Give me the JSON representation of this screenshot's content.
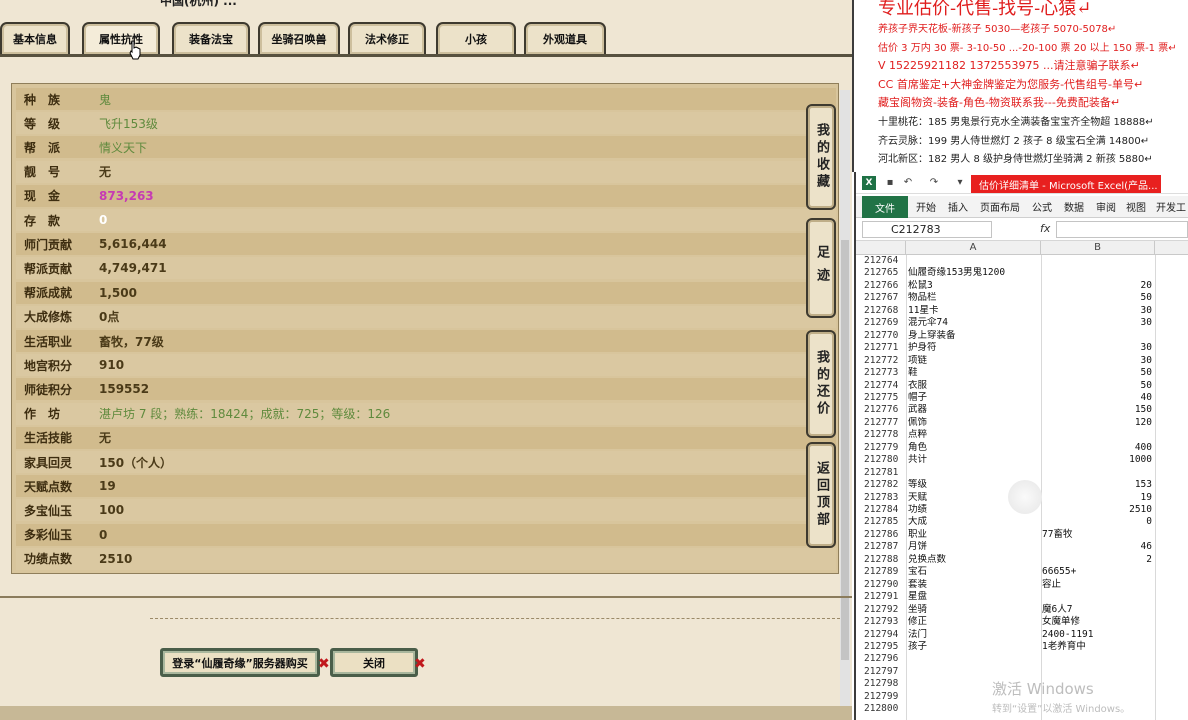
{
  "game": {
    "top_text": "中国(杭州) ...",
    "tabs": [
      "基本信息",
      "属性抗性",
      "装备法宝",
      "坐骑召唤兽",
      "法术修正",
      "小孩",
      "外观道具"
    ],
    "attributes": [
      {
        "label": "种　族",
        "value": "鬼",
        "style": "green"
      },
      {
        "label": "等　级",
        "value": "飞升153级",
        "style": "green"
      },
      {
        "label": "帮　派",
        "value": "情义天下",
        "style": "green"
      },
      {
        "label": "靓　号",
        "value": "无",
        "style": "normal"
      },
      {
        "label": "现　金",
        "value": "873,263",
        "style": "pink"
      },
      {
        "label": "存　款",
        "value": "0",
        "style": "white"
      },
      {
        "label": "师门贡献",
        "value": "5,616,444",
        "style": "normal"
      },
      {
        "label": "帮派贡献",
        "value": "4,749,471",
        "style": "normal"
      },
      {
        "label": "帮派成就",
        "value": "1,500",
        "style": "normal"
      },
      {
        "label": "大成修炼",
        "value": "0点",
        "style": "normal"
      },
      {
        "label": "生活职业",
        "value": "畜牧，77级",
        "style": "normal"
      },
      {
        "label": "地宫积分",
        "value": "910",
        "style": "normal"
      },
      {
        "label": "师徒积分",
        "value": "159552",
        "style": "normal"
      },
      {
        "label": "作　坊",
        "value": "湛卢坊 7 段；熟练：18424；成就：725；等级：126",
        "style": "green"
      },
      {
        "label": "生活技能",
        "value": "无",
        "style": "normal"
      },
      {
        "label": "家具回灵",
        "value": "150（个人）",
        "style": "normal"
      },
      {
        "label": "天赋点数",
        "value": "19",
        "style": "normal"
      },
      {
        "label": "多宝仙玉",
        "value": "100",
        "style": "normal"
      },
      {
        "label": "多彩仙玉",
        "value": "0",
        "style": "normal"
      },
      {
        "label": "功绩点数",
        "value": "2510",
        "style": "normal"
      }
    ],
    "side_buttons": [
      "我的收藏",
      "足迹",
      "我的还价",
      "返回顶部"
    ],
    "login_button": "登录“仙履奇缘”服务器购买",
    "close_button": "关闭"
  },
  "ad": {
    "title": "专业估价-代售-找号-心猿↵",
    "lines": [
      {
        "text": "养孩子界天花板-新孩子 5030—老孩子 5070-5078↵",
        "color": "red"
      },
      {
        "text": "估价 3 万内 30 票- 3-10-50 ...-20-100 票 20 以上 150 票-1 票↵",
        "color": "red"
      },
      {
        "text": "V 15225921182    1372553975   ...请注意骗子联系↵",
        "color": "red"
      },
      {
        "text": "CC 首席鉴定+大神金牌鉴定为您服务-代售组号-单号↵",
        "color": "red"
      },
      {
        "text": "藏宝阁物资-装备-角色-物资联系我---免费配装备↵",
        "color": "red"
      },
      {
        "text": "十里桃花：185 男鬼景行克水全满装备宝宝齐全物超 18888↵",
        "color": "dark"
      },
      {
        "text": "齐云灵脉：199 男人侍世燃灯 2 孩子 8 级宝石全满 14800↵",
        "color": "dark"
      },
      {
        "text": "河北新区：182 男人 8 级护身侍世燃灯坐骑满 2 新孩 5880↵",
        "color": "dark"
      }
    ]
  },
  "excel": {
    "title_badge": "估价详细清单 - Microsoft Excel(产品...",
    "ribbon_file": "文件",
    "ribbon_tabs": [
      "开始",
      "插入",
      "页面布局",
      "公式",
      "数据",
      "审阅",
      "视图",
      "开发工"
    ],
    "name_box": "C212783",
    "fx": "fx",
    "col_a": "A",
    "col_b": "B",
    "rows": [
      {
        "n": "212764",
        "a": "",
        "b": ""
      },
      {
        "n": "212765",
        "a": "仙履奇缘153男鬼1200",
        "b": ""
      },
      {
        "n": "212766",
        "a": "松鼠3",
        "b": "20"
      },
      {
        "n": "212767",
        "a": "物品栏",
        "b": "50"
      },
      {
        "n": "212768",
        "a": "11星卡",
        "b": "30"
      },
      {
        "n": "212769",
        "a": "混元伞74",
        "b": "30"
      },
      {
        "n": "212770",
        "a": "身上穿装备",
        "b": ""
      },
      {
        "n": "212771",
        "a": "护身符",
        "b": "30"
      },
      {
        "n": "212772",
        "a": "项链",
        "b": "30"
      },
      {
        "n": "212773",
        "a": "鞋",
        "b": "50"
      },
      {
        "n": "212774",
        "a": "衣服",
        "b": "50"
      },
      {
        "n": "212775",
        "a": "帽子",
        "b": "40"
      },
      {
        "n": "212776",
        "a": "武器",
        "b": "150"
      },
      {
        "n": "212777",
        "a": "佩饰",
        "b": "120"
      },
      {
        "n": "212778",
        "a": "点粹",
        "b": ""
      },
      {
        "n": "212779",
        "a": "角色",
        "b": "400"
      },
      {
        "n": "212780",
        "a": "共计",
        "b": "1000"
      },
      {
        "n": "212781",
        "a": "",
        "b": ""
      },
      {
        "n": "212782",
        "a": "等级",
        "b": "153"
      },
      {
        "n": "212783",
        "a": "天赋",
        "b": "19"
      },
      {
        "n": "212784",
        "a": "功绩",
        "b": "2510"
      },
      {
        "n": "212785",
        "a": "大成",
        "b": "0"
      },
      {
        "n": "212786",
        "a": "职业",
        "b": "77畜牧",
        "text": true
      },
      {
        "n": "212787",
        "a": "月饼",
        "b": "46"
      },
      {
        "n": "212788",
        "a": "兑换点数",
        "b": "2"
      },
      {
        "n": "212789",
        "a": "宝石",
        "b": "66655+",
        "text": true
      },
      {
        "n": "212790",
        "a": "套装",
        "b": "容止",
        "text": true
      },
      {
        "n": "212791",
        "a": "星盘",
        "b": ""
      },
      {
        "n": "212792",
        "a": "坐骑",
        "b": "魔6人7",
        "text": true
      },
      {
        "n": "212793",
        "a": "修正",
        "b": "女魔单修",
        "text": true
      },
      {
        "n": "212794",
        "a": "法门",
        "b": "2400-1191",
        "text": true
      },
      {
        "n": "212795",
        "a": "孩子",
        "b": "1老养育中",
        "text": true
      },
      {
        "n": "212796",
        "a": "",
        "b": ""
      },
      {
        "n": "212797",
        "a": "",
        "b": ""
      },
      {
        "n": "212798",
        "a": "",
        "b": ""
      },
      {
        "n": "212799",
        "a": "",
        "b": ""
      },
      {
        "n": "212800",
        "a": "",
        "b": ""
      }
    ],
    "watermark": "激活 Windows",
    "watermark_sub": "转到“设置”以激活 Windows。"
  }
}
